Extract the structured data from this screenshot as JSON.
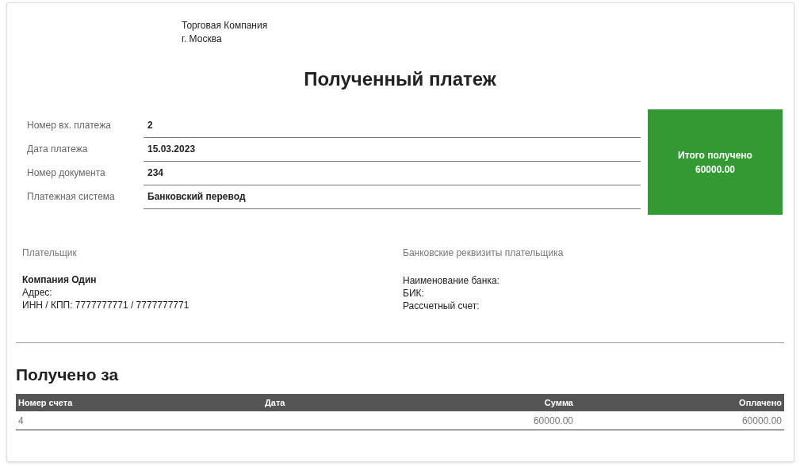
{
  "company": {
    "name": "Торговая Компания",
    "city": "г. Москва"
  },
  "title": "Полученный платеж",
  "details": [
    {
      "label": "Номер вх. платежа",
      "value": "2"
    },
    {
      "label": "Дата платежа",
      "value": "15.03.2023"
    },
    {
      "label": "Номер документа",
      "value": "234"
    },
    {
      "label": "Платежная система",
      "value": "Банковский перевод"
    }
  ],
  "total": {
    "label": "Итого получено",
    "amount": "60000.00"
  },
  "payer": {
    "heading": "Плательщик",
    "name": "Компания Один",
    "lines": [
      "Адрес:",
      "ИНН / КПП: 7777777771 / 7777777771"
    ]
  },
  "bank": {
    "heading": "Банковские реквизиты плательщика",
    "lines": [
      "Наименование банка:",
      "БИК:",
      "Рассчетный счет:"
    ]
  },
  "received_for": {
    "heading": "Получено за",
    "columns": [
      {
        "label": "Номер счета",
        "numeric": false
      },
      {
        "label": "Дата",
        "numeric": false
      },
      {
        "label": "Сумма",
        "numeric": true
      },
      {
        "label": "Оплачено",
        "numeric": true
      }
    ],
    "rows": [
      [
        "4",
        "",
        "60000.00",
        "60000.00"
      ]
    ]
  }
}
